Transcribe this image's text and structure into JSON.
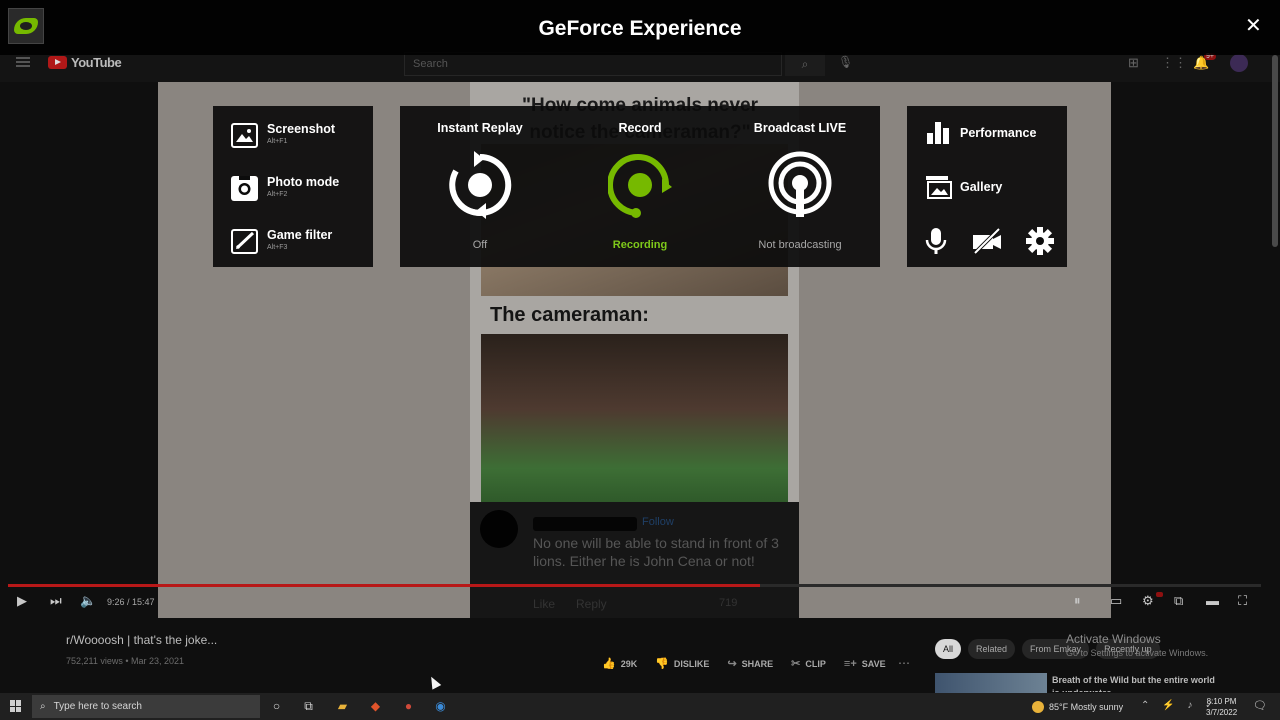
{
  "overlay": {
    "title": "GeForce Experience",
    "close": "✕",
    "left_panel": [
      {
        "label": "Screenshot",
        "shortcut": "Alt+F1"
      },
      {
        "label": "Photo mode",
        "shortcut": "Alt+F2"
      },
      {
        "label": "Game filter",
        "shortcut": "Alt+F3"
      }
    ],
    "center_panel": [
      {
        "title": "Instant Replay",
        "status": "Off"
      },
      {
        "title": "Record",
        "status": "Recording"
      },
      {
        "title": "Broadcast LIVE",
        "status": "Not broadcasting"
      }
    ],
    "right_panel": [
      {
        "label": "Performance"
      },
      {
        "label": "Gallery"
      }
    ],
    "accent_color": "#76b900"
  },
  "browser": {
    "site": "YouTube",
    "search_placeholder": "Search",
    "notification_count": "9+"
  },
  "video_frame": {
    "meme_question": "\"How come animals never notice the cameraman?\"",
    "meme_caption": "The cameraman:",
    "comment_follow": "Follow",
    "comment_text": "No one will be able to stand in front of 3 lions. Either he is John Cena or not!",
    "comment_like": "Like",
    "comment_reply": "Reply",
    "comment_reactions": "719"
  },
  "player": {
    "time": "9:26 / 15:47",
    "progress": 0.6
  },
  "video_info": {
    "title": "r/Woooosh | that's the joke...",
    "meta": "752,211 views • Mar 23, 2021",
    "likes": "29K",
    "dislike": "DISLIKE",
    "share": "SHARE",
    "clip": "CLIP",
    "save": "SAVE"
  },
  "chips": [
    "All",
    "Related",
    "From Emkay",
    "Recently up"
  ],
  "recommendation": {
    "title": "Breath of the Wild but the entire world is underwater"
  },
  "watermark": {
    "line1": "Activate Windows",
    "line2": "Go to Settings to activate Windows."
  },
  "taskbar": {
    "search_placeholder": "Type here to search",
    "weather": "85°F  Mostly sunny",
    "time": "8:10 PM",
    "date": "3/7/2022"
  }
}
